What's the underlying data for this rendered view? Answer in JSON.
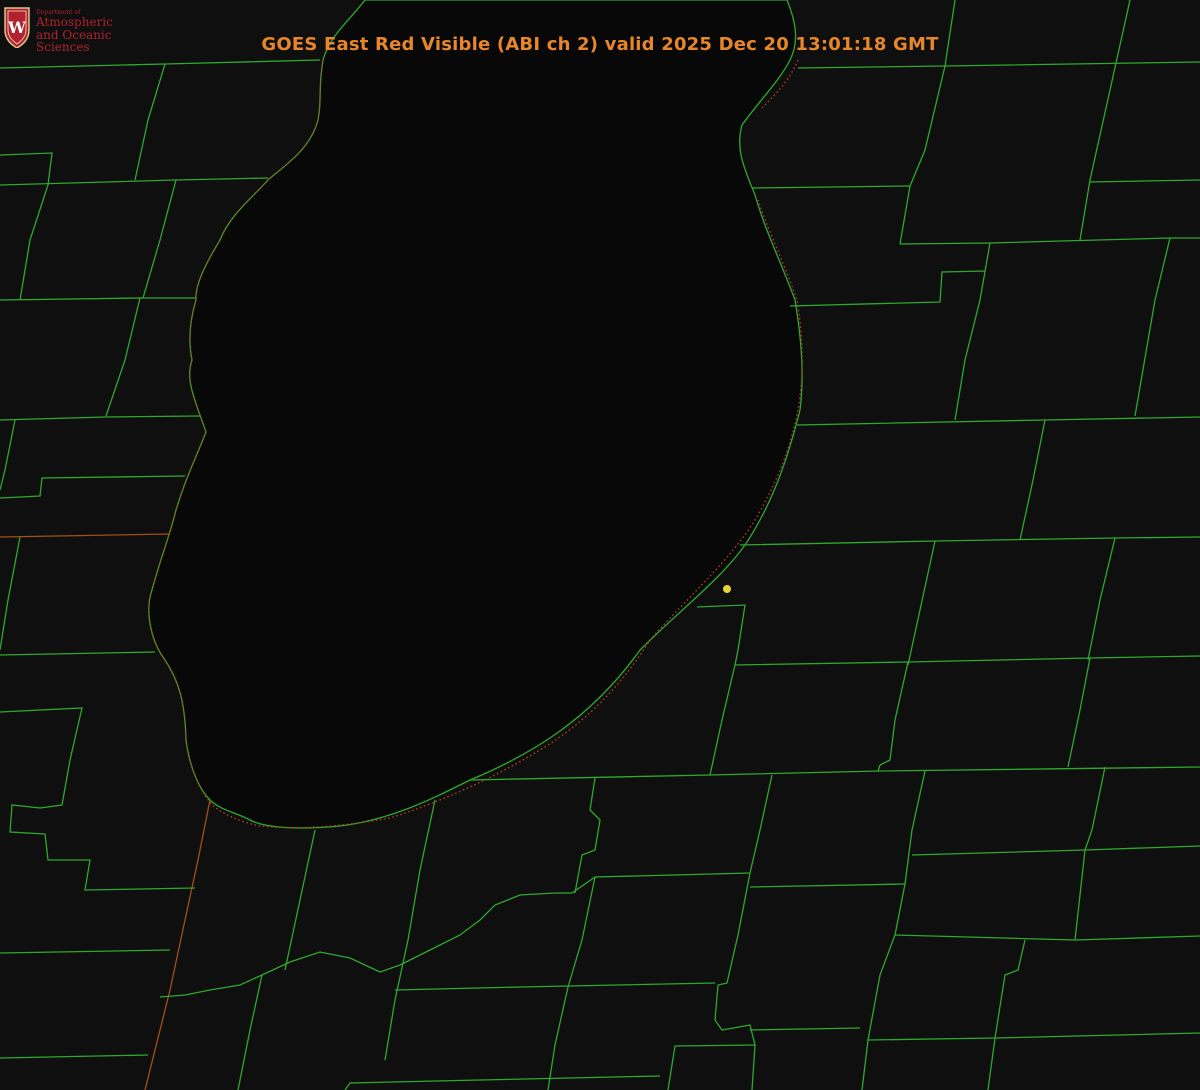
{
  "title": "GOES East Red Visible (ABI ch 2) valid 2025 Dec 20 13:01:18 GMT",
  "logo": {
    "emblem_letter": "W",
    "department": "Department of",
    "line1": "Atmospheric",
    "line2": "and Oceanic Sciences",
    "color": "#b0232e"
  },
  "colors": {
    "title": "#e8862a",
    "county_lines": "#2fa82f",
    "state_lines": "#b3401f",
    "marker": "#e6d230",
    "background": "#0d0d0d"
  },
  "marker": {
    "label": "",
    "color": "#e6d230"
  }
}
